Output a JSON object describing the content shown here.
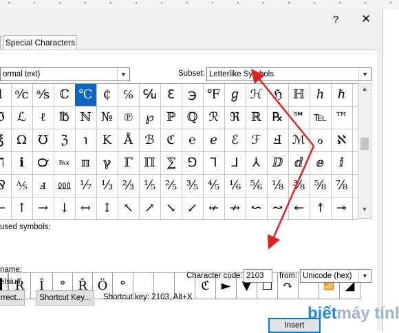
{
  "titlebar": {
    "help": "?",
    "close": "✕"
  },
  "tabs": [
    {
      "label": "Special Characters"
    }
  ],
  "font": {
    "value": "ormal text)"
  },
  "subset": {
    "label": "Subset:",
    "value": "Letterlike Symbols"
  },
  "symbol_rows": [
    [
      "l",
      "ᵃ⁄c",
      "ᵃ⁄s",
      "ℂ",
      "℃",
      "₵",
      "℅",
      "℆",
      "ℇ",
      "℈",
      "℉",
      "ℊ",
      "ℋ",
      "ℌ",
      "ℍ",
      "ℎ",
      "ℏ",
      "ℐ"
    ],
    [
      "ℑ",
      "ℒ",
      "ℓ",
      "℔",
      "ℕ",
      "№",
      "℗",
      "℘",
      "ℙ",
      "ℚ",
      "ℛ",
      "ℜ",
      "ℝ",
      "℞",
      "℠",
      "℡",
      "™",
      "℣"
    ],
    [
      "ℤ",
      "℥",
      "Ω",
      "℧",
      "ℨ",
      "℩",
      "K",
      "Å",
      "ℬ",
      "ℭ",
      "℮",
      "ℯ",
      "ℰ",
      "ℱ",
      "Ⅎ",
      "ℳ",
      "ℴ",
      "ℵ",
      "ℶ"
    ],
    [
      "ℷ",
      "ℸ",
      "ℹ",
      "℺",
      "℻",
      "ℼ",
      "ℽ",
      "ℾ",
      "ℿ",
      "⅀",
      "⅁",
      "⅂",
      "⅃",
      "⅄",
      "ⅅ",
      "ⅆ",
      "ⅇ",
      "ⅈ",
      "ⅉ"
    ],
    [
      "⅊",
      "⅋",
      "⅍",
      "ⅎ",
      "⅏",
      "⅐",
      "⅓",
      "⅔",
      "⅕",
      "⅖",
      "⅗",
      "⅘",
      "⅙",
      "⅚",
      "⅛",
      "⅜",
      "⅝",
      "⅞",
      "⅟"
    ],
    [
      "←",
      "↑",
      "→",
      "↓",
      "↔",
      "↕",
      "↖",
      "↗",
      "↘",
      "↙",
      "↚",
      "↛",
      "↜",
      "↝",
      "↞",
      "↟",
      "↠",
      "↡",
      "↢"
    ]
  ],
  "recent": {
    "label": "used symbols:",
    "items": [
      "▌",
      "R̃",
      "Î",
      "°",
      "Ř",
      "Ö",
      "°",
      "",
      "",
      "",
      "ℭ",
      "►",
      "▼",
      "☐",
      "↷",
      "‾",
      "📶",
      "◢"
    ]
  },
  "char_info": {
    "name_label": "name:",
    "name_value": "elsius"
  },
  "character_code": {
    "label": "Character code:",
    "value": "2103"
  },
  "from": {
    "label": "from:",
    "value": "Unicode (hex)"
  },
  "buttons": {
    "autocorrect": "rrect...",
    "shortcut_key": "Shortcut Key...",
    "insert": "Insert"
  },
  "shortcut_text": "Shortcut key: 2103, Alt+X",
  "watermark": {
    "part1": "biết",
    "part2": "máy tính"
  },
  "colors": {
    "selection": "#0a67c7",
    "arrow": "#e32020",
    "watermark_blue": "#1e88e5",
    "default_button": "#0078d7"
  }
}
